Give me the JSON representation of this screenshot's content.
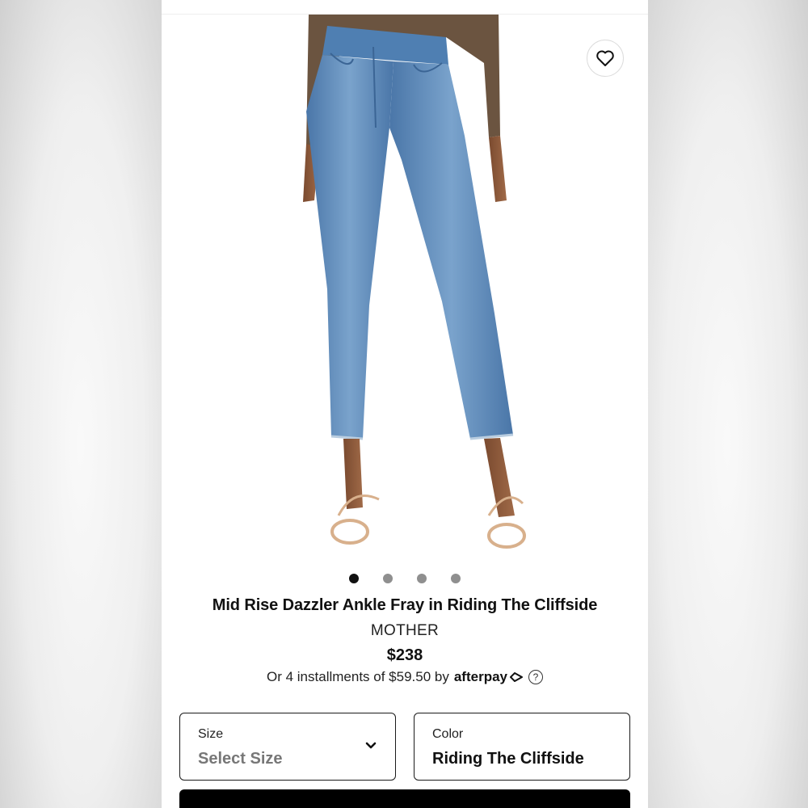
{
  "product": {
    "title": "Mid Rise Dazzler Ankle Fray in Riding The Cliffside",
    "brand": "MOTHER",
    "price": "$238",
    "installments_prefix": "Or 4 installments of $59.50 by",
    "afterpay_brand": "afterpay",
    "image_icon": "jeans-product-photo",
    "gallery": {
      "total_images": 4,
      "active_index": 0
    }
  },
  "options": {
    "size_label": "Size",
    "size_value": "Select Size",
    "color_label": "Color",
    "color_value": "Riding The Cliffside"
  },
  "icons": {
    "wishlist": "heart-icon",
    "dropdown": "chevron-down-icon",
    "help": "question-circle-icon",
    "afterpay": "afterpay-arrows-icon"
  },
  "colors": {
    "denim": "#5b87b8",
    "button": "#000000",
    "active_dot": "#111111",
    "inactive_dot": "#8f8f8f"
  }
}
